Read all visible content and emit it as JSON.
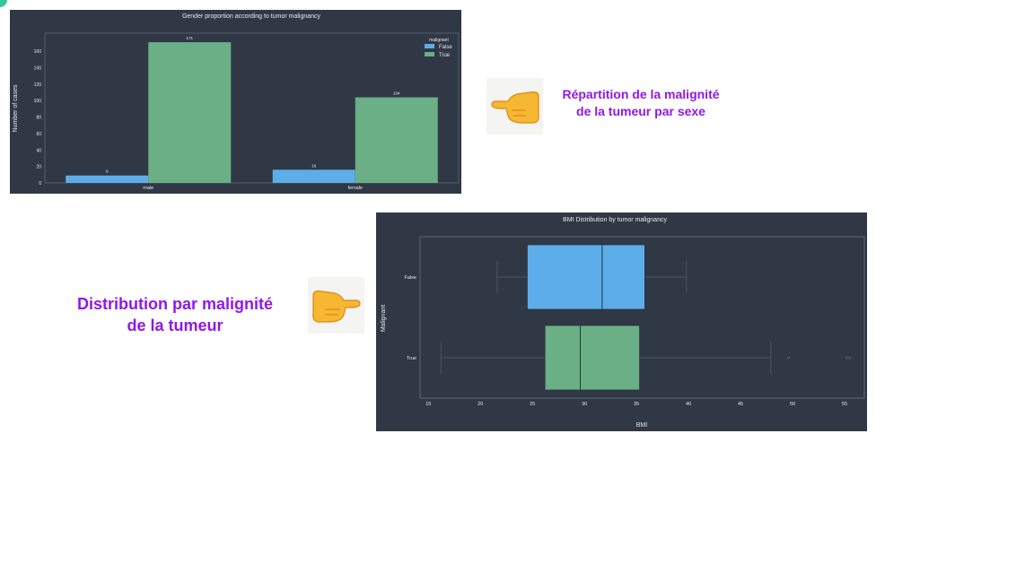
{
  "captions": {
    "top_line1": "Répartition de la malignité",
    "top_line2": "de la tumeur par sexe",
    "left_line1": "Distribution par malignité",
    "left_line2": "de la tumeur"
  },
  "icons": {
    "pointing_hand": "backhand-index-pointing-right"
  },
  "colors": {
    "false_series": "#5dade8",
    "true_series": "#6aaf85",
    "panel_background": "#303846",
    "caption_text": "#8f18e8"
  },
  "chart_data": [
    {
      "type": "bar",
      "title": "Gender proportion according to tumor malignancy",
      "xlabel": "",
      "ylabel": "Number of cases",
      "categories": [
        "male",
        "female"
      ],
      "legend_title": "malignant",
      "legend_position": "top-right",
      "series": [
        {
          "name": "False",
          "values": [
            9,
            16
          ],
          "labels": [
            "9",
            "16"
          ]
        },
        {
          "name": "True",
          "values": [
            171,
            104
          ],
          "labels": [
            "171",
            "104"
          ]
        }
      ],
      "ylim": [
        0,
        182
      ],
      "yticks": [
        0,
        20,
        40,
        60,
        80,
        100,
        120,
        140,
        160
      ],
      "grid": false
    },
    {
      "type": "box",
      "title": "BMI Distribution by tumor malignancy",
      "xlabel": "BMI",
      "ylabel": "Malignant",
      "categories": [
        "False",
        "True"
      ],
      "xlim": [
        14.2,
        56.9
      ],
      "xticks": [
        15,
        20,
        25,
        30,
        35,
        40,
        45,
        50,
        55
      ],
      "grid": false,
      "boxes": [
        {
          "name": "False",
          "whisker_low": 21.6,
          "q1": 24.5,
          "median": 31.7,
          "q3": 35.8,
          "whisker_high": 39.8,
          "outliers": []
        },
        {
          "name": "True",
          "whisker_low": 16.2,
          "q1": 26.2,
          "median": 29.6,
          "q3": 35.3,
          "whisker_high": 47.9,
          "outliers": [
            49.6,
            55.2,
            55.5
          ]
        }
      ]
    }
  ]
}
